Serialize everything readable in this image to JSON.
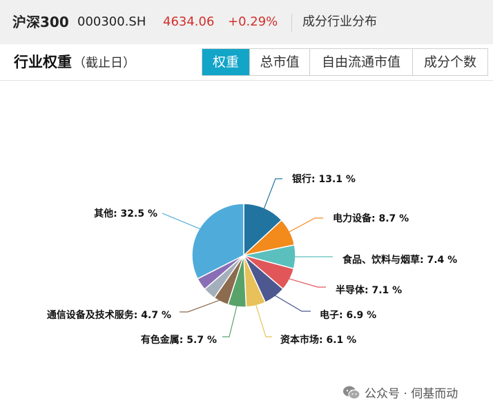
{
  "header": {
    "index_name": "沪深300",
    "code": "000300.SH",
    "price": "4634.06",
    "change": "+0.29%",
    "tab": "成分行业分布"
  },
  "section": {
    "title": "行业权重",
    "subtitle": "（截止日）"
  },
  "segmented": {
    "options": [
      "权重",
      "总市值",
      "自由流通市值",
      "成分个数"
    ],
    "active": "权重"
  },
  "watermark": "公众号 · 伺基而动",
  "chart_data": {
    "type": "pie",
    "title": "",
    "unit": "%",
    "slices": [
      {
        "label": "银行",
        "value": 13.1,
        "color": "#2174a0",
        "text": "银行: 13.1 %"
      },
      {
        "label": "电力设备",
        "value": 8.7,
        "color": "#f28a1c",
        "text": "电力设备: 8.7 %"
      },
      {
        "label": "食品、饮料与烟草",
        "value": 7.4,
        "color": "#5bbfbd",
        "text": "食品、饮料与烟草: 7.4 %"
      },
      {
        "label": "半导体",
        "value": 7.1,
        "color": "#e15659",
        "text": "半导体: 7.1 %"
      },
      {
        "label": "电子",
        "value": 6.9,
        "color": "#4c588f",
        "text": "电子: 6.9 %"
      },
      {
        "label": "资本市场",
        "value": 6.1,
        "color": "#e8c15a",
        "text": "资本市场: 6.1 %"
      },
      {
        "label": "有色金属",
        "value": 5.7,
        "color": "#58a36a",
        "text": "有色金属: 5.7 %"
      },
      {
        "label": "通信设备及技术服务",
        "value": 4.7,
        "color": "#8c6b4f",
        "text": "通信设备及技术服务: 4.7 %"
      },
      {
        "label": "",
        "value": 4.0,
        "color": "#a3afba",
        "text": ""
      },
      {
        "label": "",
        "value": 3.9,
        "color": "#8a6eb5",
        "text": ""
      },
      {
        "label": "其他",
        "value": 32.5,
        "color": "#4fabd9",
        "text": "其他: 32.5 %"
      }
    ]
  }
}
